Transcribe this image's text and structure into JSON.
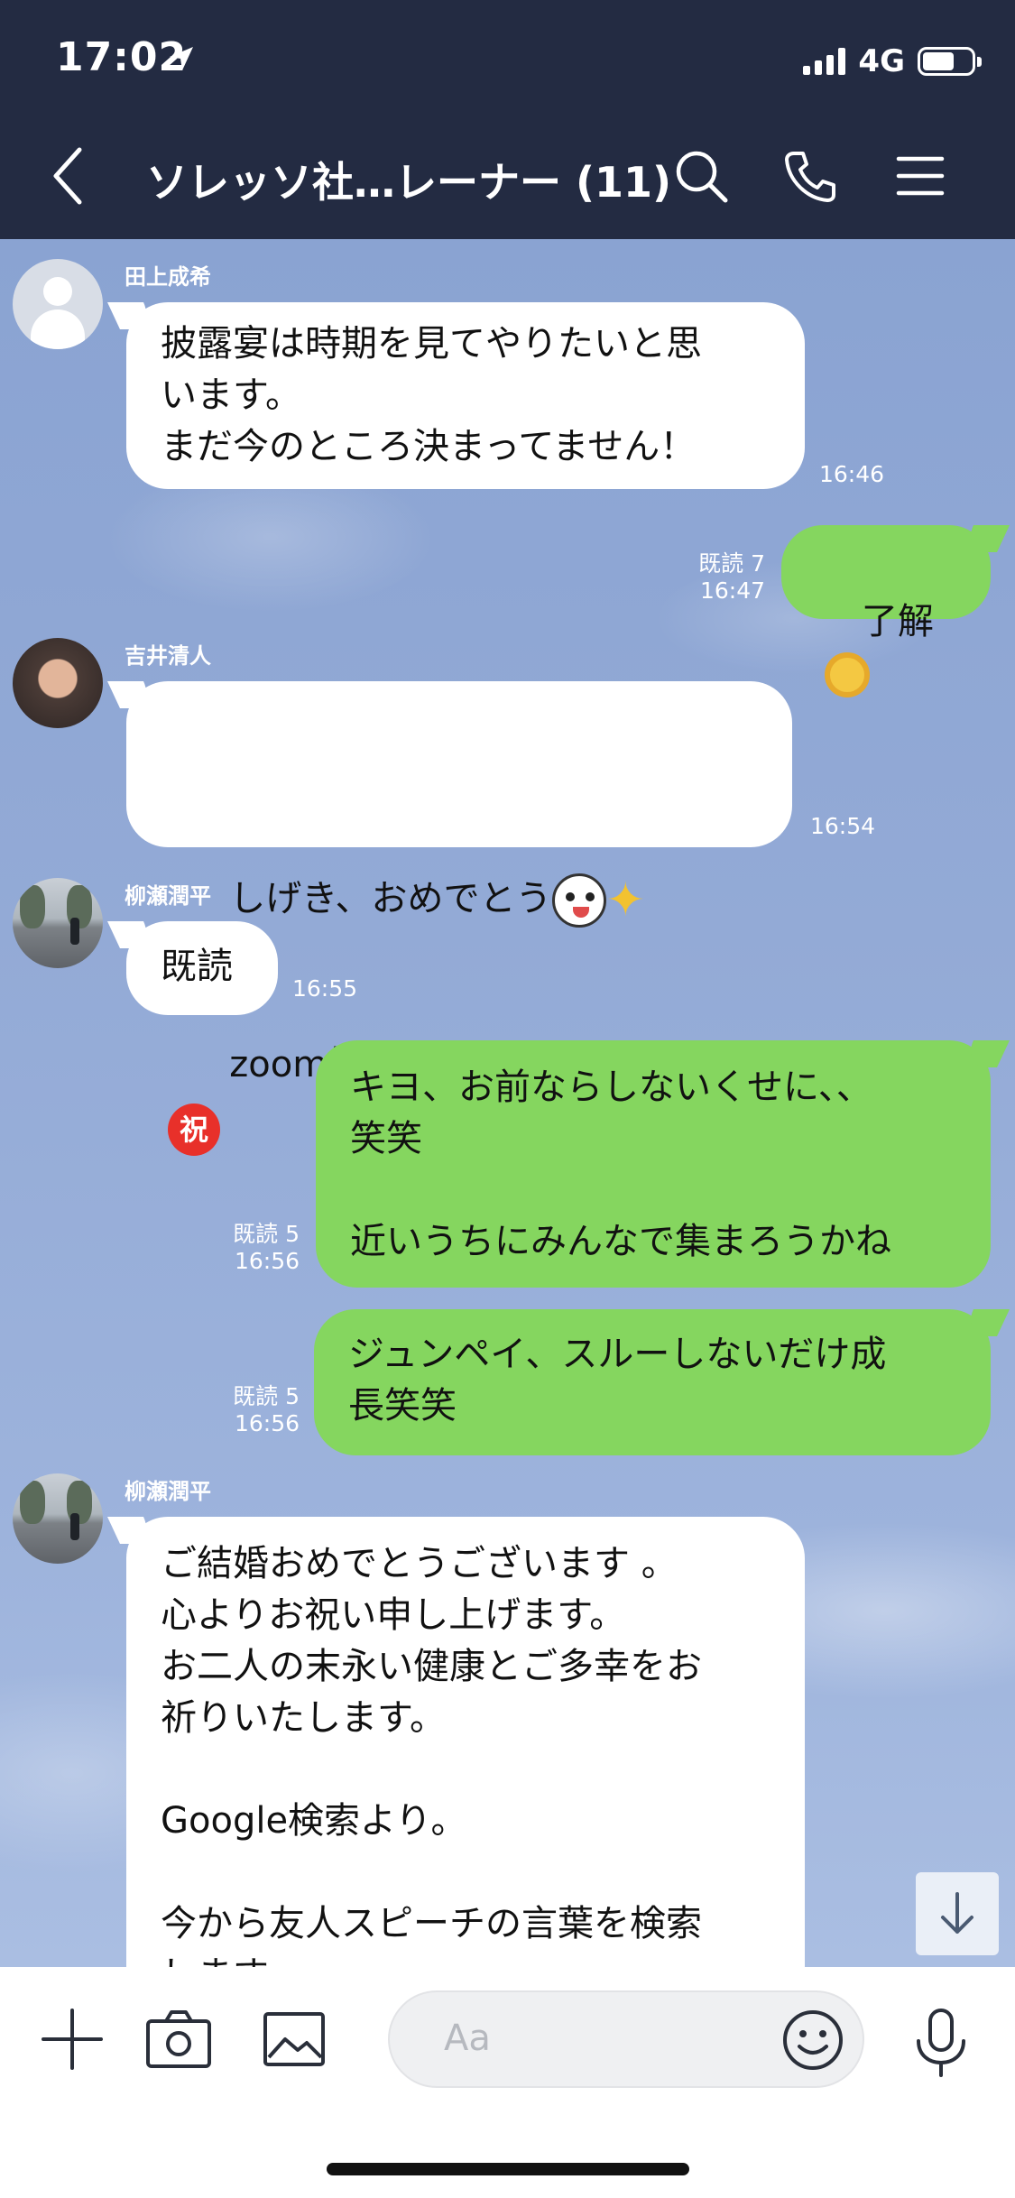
{
  "status_bar": {
    "time": "17:02",
    "network": "4G"
  },
  "header": {
    "title": "ソレッソ社…レーナー (11)",
    "icons": [
      "back-icon",
      "search-icon",
      "phone-icon",
      "menu-icon"
    ]
  },
  "messages": [
    {
      "sender": "田上成希",
      "text": "披露宴は時期を見てやりたいと思\nいます。\nまだ今のところ決まってません！",
      "time": "16:46"
    },
    {
      "text": "了解",
      "read": "既読 7",
      "time": "16:47",
      "emoji": "ok-hand-emoji"
    },
    {
      "sender": "吉井清人",
      "line1": "しげき、おめでとう",
      "line2": "zoom披露宴にしますか笑",
      "time": "16:54",
      "badge": "祝"
    },
    {
      "sender": "柳瀬潤平",
      "text": "既読",
      "time": "16:55"
    },
    {
      "text": "キヨ、お前ならしないくせに、、\n笑笑\n\n近いうちにみんなで集まろうかね",
      "read": "既読 5",
      "time": "16:56"
    },
    {
      "text": "ジュンペイ、スルーしないだけ成\n長笑笑",
      "read": "既読 5",
      "time": "16:56"
    },
    {
      "sender": "柳瀬潤平",
      "text": "ご結婚おめでとうございます 。\n心よりお祝い申し上げます。\nお二人の末永い健康とご多幸をお\n祈りいたします。\n\nGoogle検索より。\n\n今から友人スピーチの言葉を検索\nします"
    }
  ],
  "input": {
    "placeholder": "Aa"
  },
  "colors": {
    "header_bg": "#232b42",
    "bubble_out": "#85d65f",
    "bubble_in": "#ffffff"
  }
}
